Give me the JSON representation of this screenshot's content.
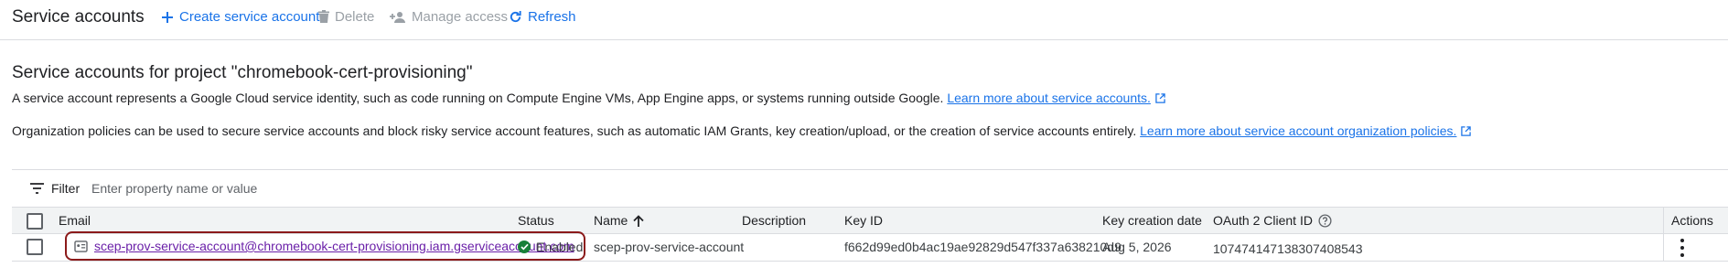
{
  "toolbar": {
    "title": "Service accounts",
    "create_label": "Create service account",
    "delete_label": "Delete",
    "manage_access_label": "Manage access",
    "refresh_label": "Refresh"
  },
  "main": {
    "section_title": "Service accounts for project \"chromebook-cert-provisioning\"",
    "desc1_text": "A service account represents a Google Cloud service identity, such as code running on Compute Engine VMs, App Engine apps, or systems running outside Google.",
    "desc1_link": "Learn more about service accounts.",
    "desc2_text": "Organization policies can be used to secure service accounts and block risky service account features, such as automatic IAM Grants, key creation/upload, or the creation of service accounts entirely.",
    "desc2_link": "Learn more about service account organization policies."
  },
  "filter": {
    "label": "Filter",
    "placeholder": "Enter property name or value"
  },
  "table": {
    "headers": {
      "email": "Email",
      "status": "Status",
      "name": "Name",
      "description": "Description",
      "key_id": "Key ID",
      "key_creation_date": "Key creation date",
      "oauth_client_id": "OAuth 2 Client ID",
      "actions": "Actions"
    },
    "rows": [
      {
        "email": "scep-prov-service-account@chromebook-cert-provisioning.iam.gserviceaccount.com",
        "status": "Enabled",
        "name": "scep-prov-service-account",
        "description": "",
        "key_id": "f662d99ed0b4ac19ae92829d547f337a638210d9",
        "key_creation_date": "Aug 5, 2026",
        "oauth_client_id": "107474147138307408543"
      }
    ]
  },
  "colors": {
    "accent": "#1a73e8",
    "enabled": "#188038",
    "highlight_border": "#8b1a1a",
    "visited_link": "#6a1fa8"
  },
  "icons": [
    "plus-icon",
    "trash-icon",
    "person-add-icon",
    "refresh-icon",
    "external-link-icon",
    "filter-icon",
    "arrow-up-icon",
    "help-icon",
    "service-account-icon",
    "check-circle-icon",
    "more-vert-icon"
  ]
}
